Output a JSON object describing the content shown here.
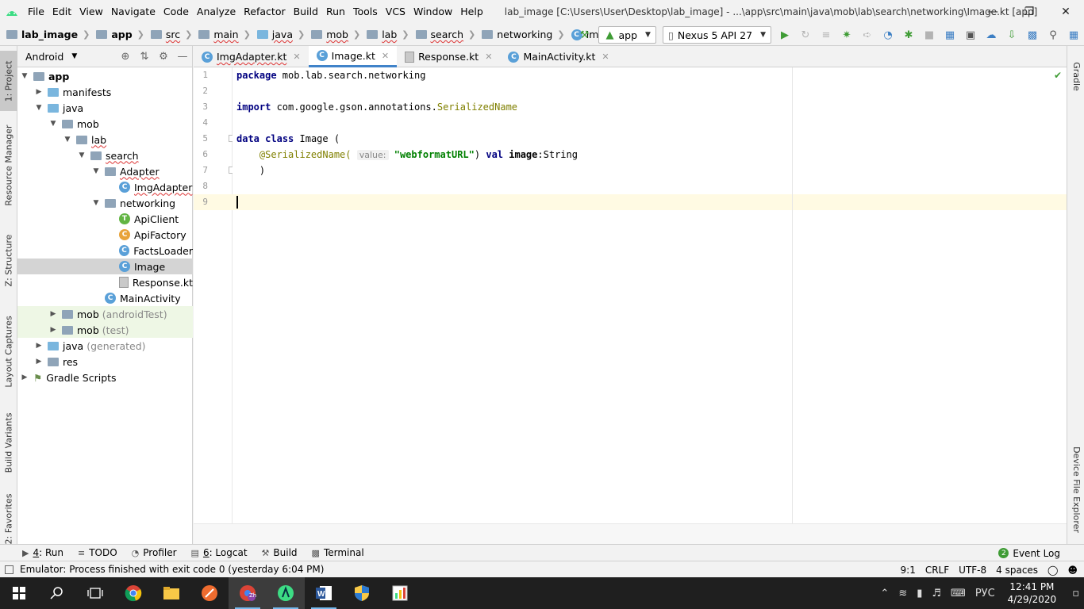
{
  "window": {
    "title": "lab_image [C:\\Users\\User\\Desktop\\lab_image] - ...\\app\\src\\main\\java\\mob\\lab\\search\\networking\\Image.kt [app]"
  },
  "menu": [
    "File",
    "Edit",
    "View",
    "Navigate",
    "Code",
    "Analyze",
    "Refactor",
    "Build",
    "Run",
    "Tools",
    "VCS",
    "Window",
    "Help"
  ],
  "breadcrumb": [
    "lab_image",
    "app",
    "src",
    "main",
    "java",
    "mob",
    "lab",
    "search",
    "networking",
    "Image"
  ],
  "toolbar": {
    "run_config": "app",
    "device": "Nexus 5 API 27"
  },
  "project_panel": {
    "view_mode": "Android",
    "tree": [
      {
        "label": "app",
        "muted": ""
      },
      {
        "label": "manifests",
        "muted": ""
      },
      {
        "label": "java",
        "muted": ""
      },
      {
        "label": "mob",
        "muted": ""
      },
      {
        "label": "lab",
        "muted": ""
      },
      {
        "label": "search",
        "muted": ""
      },
      {
        "label": "Adapter",
        "muted": ""
      },
      {
        "label": "ImgAdapter",
        "muted": ""
      },
      {
        "label": "networking",
        "muted": ""
      },
      {
        "label": "ApiClient",
        "muted": ""
      },
      {
        "label": "ApiFactory",
        "muted": ""
      },
      {
        "label": "FactsLoader",
        "muted": ""
      },
      {
        "label": "Image",
        "muted": ""
      },
      {
        "label": "Response.kt",
        "muted": ""
      },
      {
        "label": "MainActivity",
        "muted": ""
      },
      {
        "label": "mob",
        "muted": "(androidTest)"
      },
      {
        "label": "mob",
        "muted": "(test)"
      },
      {
        "label": "java",
        "muted": "(generated)"
      },
      {
        "label": "res",
        "muted": ""
      },
      {
        "label": "Gradle Scripts",
        "muted": ""
      }
    ]
  },
  "side_tabs_left": [
    "1: Project",
    "Resource Manager",
    "Z: Structure",
    "Layout Captures",
    "Build Variants",
    "2: Favorites"
  ],
  "side_tabs_right": [
    "Gradle",
    "Device File Explorer"
  ],
  "editor_tabs": [
    "ImgAdapter.kt",
    "Image.kt",
    "Response.kt",
    "MainActivity.kt"
  ],
  "code": {
    "line_numbers": [
      "1",
      "2",
      "3",
      "4",
      "5",
      "6",
      "7",
      "8",
      "9"
    ],
    "l1_kw": "package",
    "l1_rest": " mob.lab.search.networking",
    "l3_kw": "import",
    "l3_rest": " com.google.gson.annotations.",
    "l3_ann": "SerializedName",
    "l5_kw1": "data",
    "l5_kw2": "class",
    "l5_rest": " Image (",
    "l6_ann": "@SerializedName(",
    "l6_hint": "value:",
    "l6_str": "\"webformatURL\"",
    "l6_close": ") ",
    "l6_kw": "val",
    "l6_name": " image",
    "l6_type": ":String",
    "l7": "    )"
  },
  "tool_tabs": [
    {
      "num": "4",
      "label": ": Run"
    },
    {
      "num": "",
      "label": "TODO"
    },
    {
      "num": "",
      "label": "Profiler"
    },
    {
      "num": "6",
      "label": ": Logcat"
    },
    {
      "num": "",
      "label": "Build"
    },
    {
      "num": "",
      "label": "Terminal"
    }
  ],
  "event_log": "Event Log",
  "status": {
    "message": "Emulator: Process finished with exit code 0 (yesterday 6:04 PM)",
    "position": "9:1",
    "line_sep": "CRLF",
    "encoding": "UTF-8",
    "indent": "4 spaces"
  },
  "taskbar": {
    "lang": "РУС",
    "time": "12:41 PM",
    "date": "4/29/2020",
    "chrome_badge": "Zh"
  },
  "colors": {
    "accent": "#4083c9",
    "keyword": "#000080",
    "annotation": "#808000",
    "string": "#008000",
    "taskbar": "#1f1f1f"
  }
}
